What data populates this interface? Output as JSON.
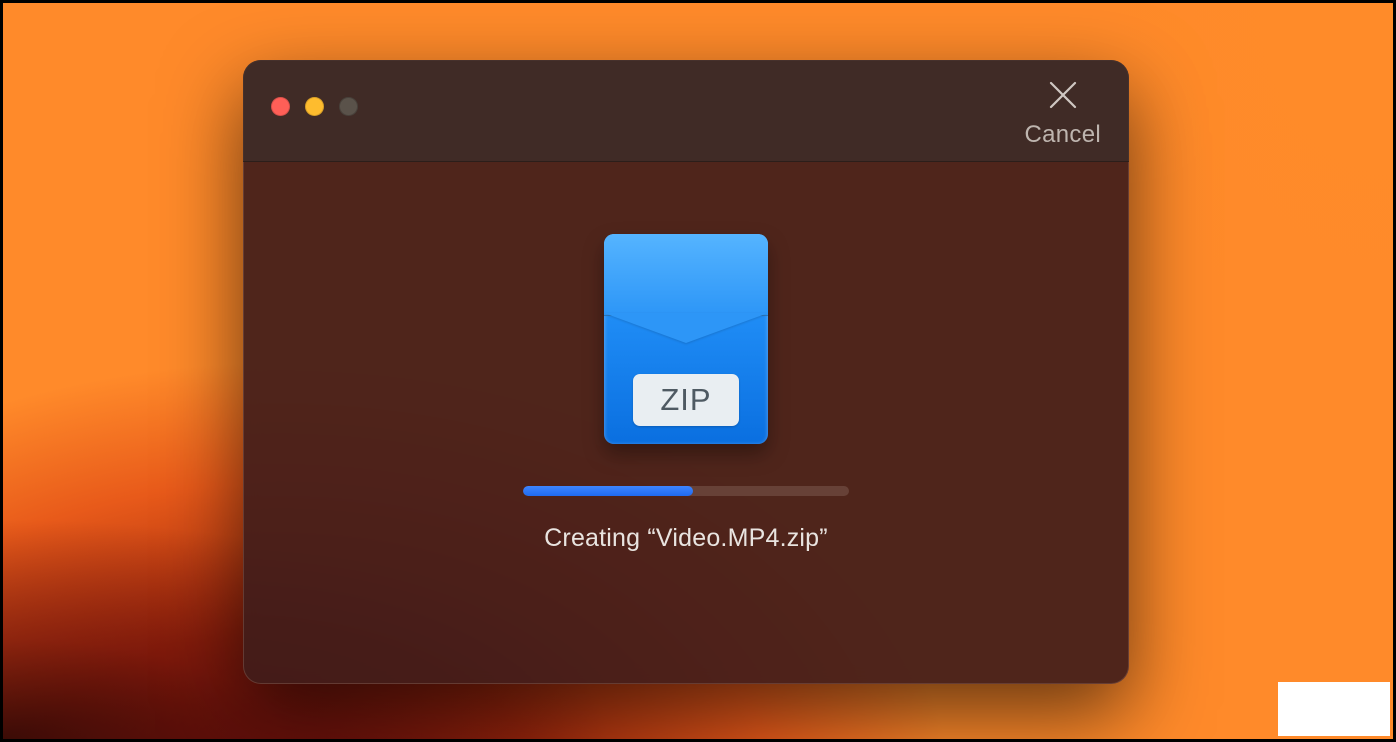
{
  "dialog": {
    "cancel_label": "Cancel",
    "status_text": "Creating “Video.MP4.zip”",
    "progress_percent": 52,
    "icon": {
      "type": "zip-archive",
      "badge_text": "ZIP"
    }
  },
  "colors": {
    "accent_blue": "#1f6af0",
    "window_bg": "#401c1a",
    "titlebar_bg": "#3c2e2a"
  }
}
